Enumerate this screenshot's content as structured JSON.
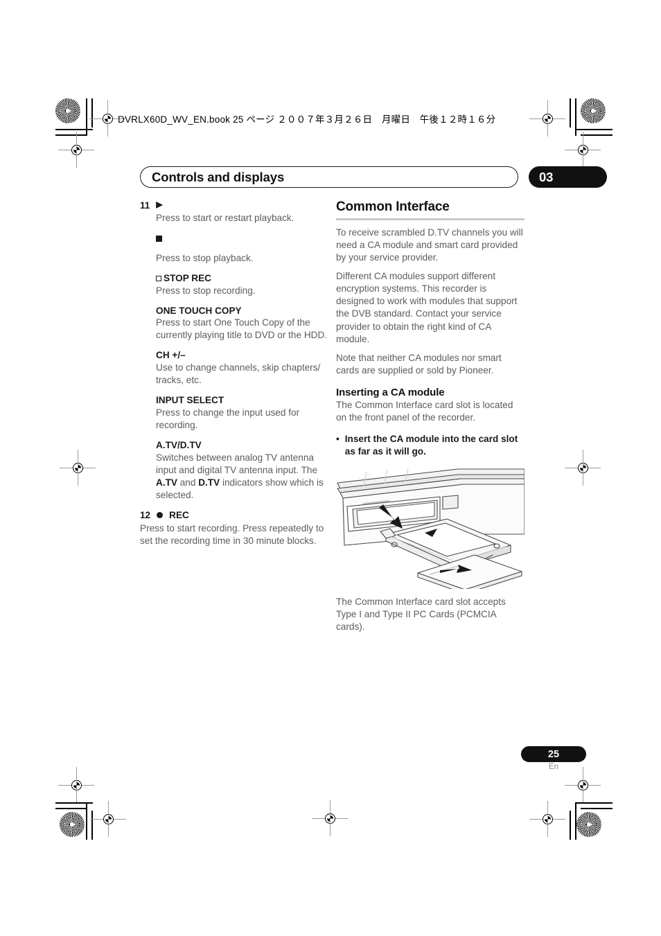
{
  "print_marks": {
    "book_path_line": "DVRLX60D_WV_EN.book  25 ページ  ２００７年３月２６日　月曜日　午後１２時１６分"
  },
  "header": {
    "chapter_title": "Controls and displays",
    "chapter_number": "03"
  },
  "left_column": {
    "items": [
      {
        "number": "11",
        "symbol": "play-triangle",
        "symbol_glyph": "▶",
        "description": "Press to start or restart playback."
      },
      {
        "symbol": "stop-square",
        "description": "Press to stop playback."
      },
      {
        "symbol": "stop-rec-open-square",
        "term": "STOP REC",
        "description": "Press to stop recording."
      },
      {
        "term": "ONE TOUCH COPY",
        "description": "Press to start One Touch Copy of the currently playing title to DVD or the HDD."
      },
      {
        "term": "CH +/–",
        "description": "Use to change channels, skip chapters/ tracks, etc."
      },
      {
        "term": "INPUT SELECT",
        "description": "Press to change the input used for recording."
      },
      {
        "term": "A.TV/D.TV",
        "description_part1": "Switches between analog TV antenna input and digital TV antenna input. The ",
        "description_bold1": "A.TV",
        "description_part2": " and ",
        "description_bold2": "D.TV",
        "description_part3": " indicators show which is selected."
      },
      {
        "number": "12",
        "symbol": "rec-dot",
        "term": "REC",
        "description": "Press to start recording. Press repeatedly to set the recording time in 30 minute blocks."
      }
    ]
  },
  "right_column": {
    "section_heading": "Common Interface",
    "paragraphs": [
      "To receive scrambled D.TV channels you will need a CA module and smart card provided by your service provider.",
      "Different CA modules support different encryption systems. This recorder is designed to work with modules that support the DVB standard. Contact your service provider to obtain the right kind of CA module.",
      "Note that neither CA modules nor smart cards are supplied or sold by Pioneer."
    ],
    "sub_heading": "Inserting a CA module",
    "sub_paragraph": "The Common Interface card slot is located on the front panel of the recorder.",
    "step_bullet": "•",
    "step_text": "Insert the CA module into the card slot as far as it will go.",
    "figure_name": "ca-module-insertion-diagram",
    "figure_caption": "The Common Interface card slot accepts Type I and Type II PC Cards (PCMCIA cards)."
  },
  "footer": {
    "page_number": "25",
    "language_code": "En"
  },
  "colors": {
    "body_text": "#5c5c5c",
    "heading_text": "#111111",
    "badge_background": "#111111",
    "rule": "#c9c9c9"
  }
}
